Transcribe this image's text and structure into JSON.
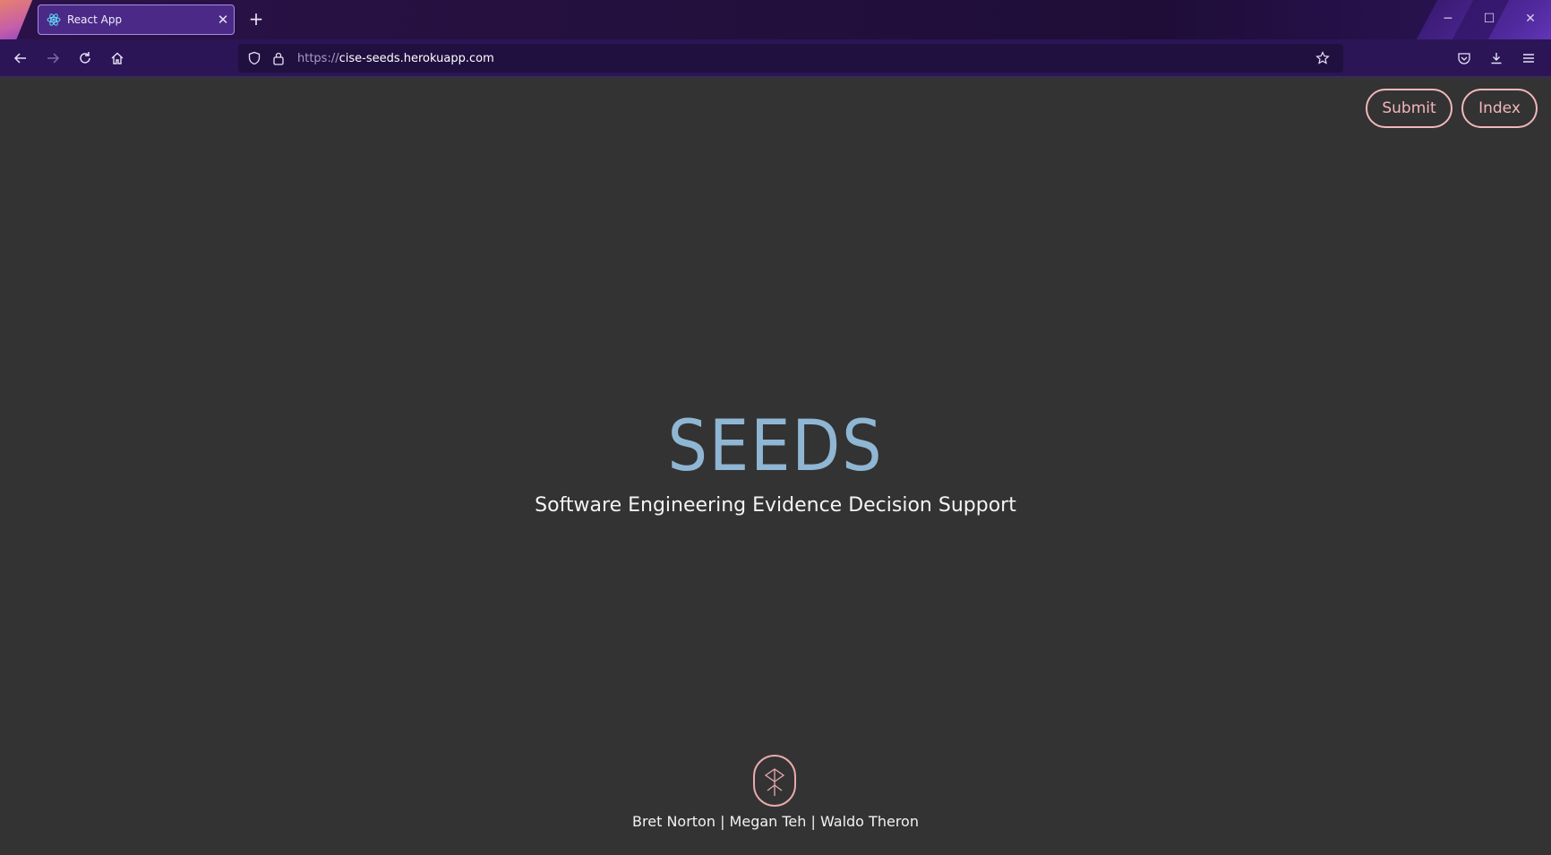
{
  "browser": {
    "tab": {
      "title": "React App",
      "favicon": "react-icon"
    },
    "url": {
      "protocol": "https://",
      "host": "cise-seeds.herokuapp.com"
    },
    "icons": [
      "back-icon",
      "forward-icon",
      "reload-icon",
      "home-icon",
      "shield-icon",
      "lock-icon",
      "bookmark-star-icon",
      "pocket-icon",
      "download-icon",
      "menu-icon",
      "minimize-icon",
      "maximize-icon",
      "close-icon",
      "new-tab-icon"
    ]
  },
  "nav": {
    "submit_label": "Submit",
    "index_label": "Index"
  },
  "hero": {
    "title": "SEEDS",
    "subtitle": "Software Engineering Evidence Decision Support"
  },
  "footer": {
    "logo": "seed-sprout-logo",
    "credits": "Bret Norton | Megan Teh | Waldo Theron"
  },
  "colors": {
    "page_bg": "#333333",
    "accent_pink": "#f2b7bb",
    "title_blue": "#8fb6d3",
    "chrome_purple": "#2b1556"
  }
}
